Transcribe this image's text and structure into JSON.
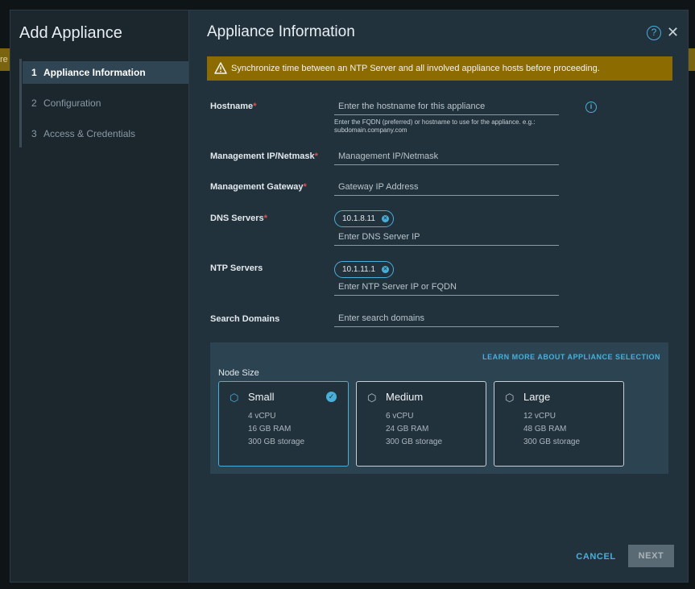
{
  "colors": {
    "accent": "#49afd9",
    "warning": "#8c6c00",
    "required": "#e0524f",
    "dialog_bg": "#22323d",
    "sidebar_bg": "#1b262d"
  },
  "wizard": {
    "title": "Add Appliance",
    "steps": [
      {
        "num": "1",
        "label": "Appliance Information",
        "active": true
      },
      {
        "num": "2",
        "label": "Configuration",
        "active": false
      },
      {
        "num": "3",
        "label": "Access & Credentials",
        "active": false
      }
    ]
  },
  "main": {
    "title": "Appliance Information",
    "help_icon": "help-circle-icon",
    "close_icon": "close-icon",
    "banner": {
      "icon": "warning-triangle-icon",
      "text": "Synchronize time between an NTP Server and all involved appliance hosts before proceeding."
    }
  },
  "form": {
    "hostname": {
      "label": "Hostname",
      "required": "*",
      "placeholder": "Enter the hostname for this appliance",
      "value": "",
      "hint": "Enter the FQDN (preferred) or hostname to use for the appliance. e.g.: subdomain.company.com",
      "info_icon": "info-circle-icon"
    },
    "mgmt_ip": {
      "label": "Management IP/Netmask",
      "required": "*",
      "placeholder": "Management IP/Netmask",
      "value": ""
    },
    "mgmt_gateway": {
      "label": "Management Gateway",
      "required": "*",
      "placeholder": "Gateway IP Address",
      "value": ""
    },
    "dns": {
      "label": "DNS Servers",
      "required": "*",
      "chips": [
        "10.1.8.11"
      ],
      "placeholder": "Enter DNS Server IP",
      "value": ""
    },
    "ntp": {
      "label": "NTP Servers",
      "chips": [
        "10.1.11.1"
      ],
      "placeholder": "Enter NTP Server IP or FQDN",
      "value": ""
    },
    "search_domains": {
      "label": "Search Domains",
      "placeholder": "Enter search domains",
      "value": ""
    }
  },
  "node_size": {
    "label": "Node Size",
    "learn_more": "LEARN MORE ABOUT APPLIANCE SELECTION",
    "cards": [
      {
        "name": "Small",
        "vcpu": "4 vCPU",
        "ram": "16 GB RAM",
        "storage": "300 GB storage",
        "selected": true,
        "icon": "cube-icon"
      },
      {
        "name": "Medium",
        "vcpu": "6 vCPU",
        "ram": "24 GB RAM",
        "storage": "300 GB storage",
        "selected": false,
        "icon": "cube-icon"
      },
      {
        "name": "Large",
        "vcpu": "12 vCPU",
        "ram": "48 GB RAM",
        "storage": "300 GB storage",
        "selected": false,
        "icon": "cube-icon"
      }
    ]
  },
  "footer": {
    "cancel_label": "CANCEL",
    "next_label": "NEXT"
  }
}
